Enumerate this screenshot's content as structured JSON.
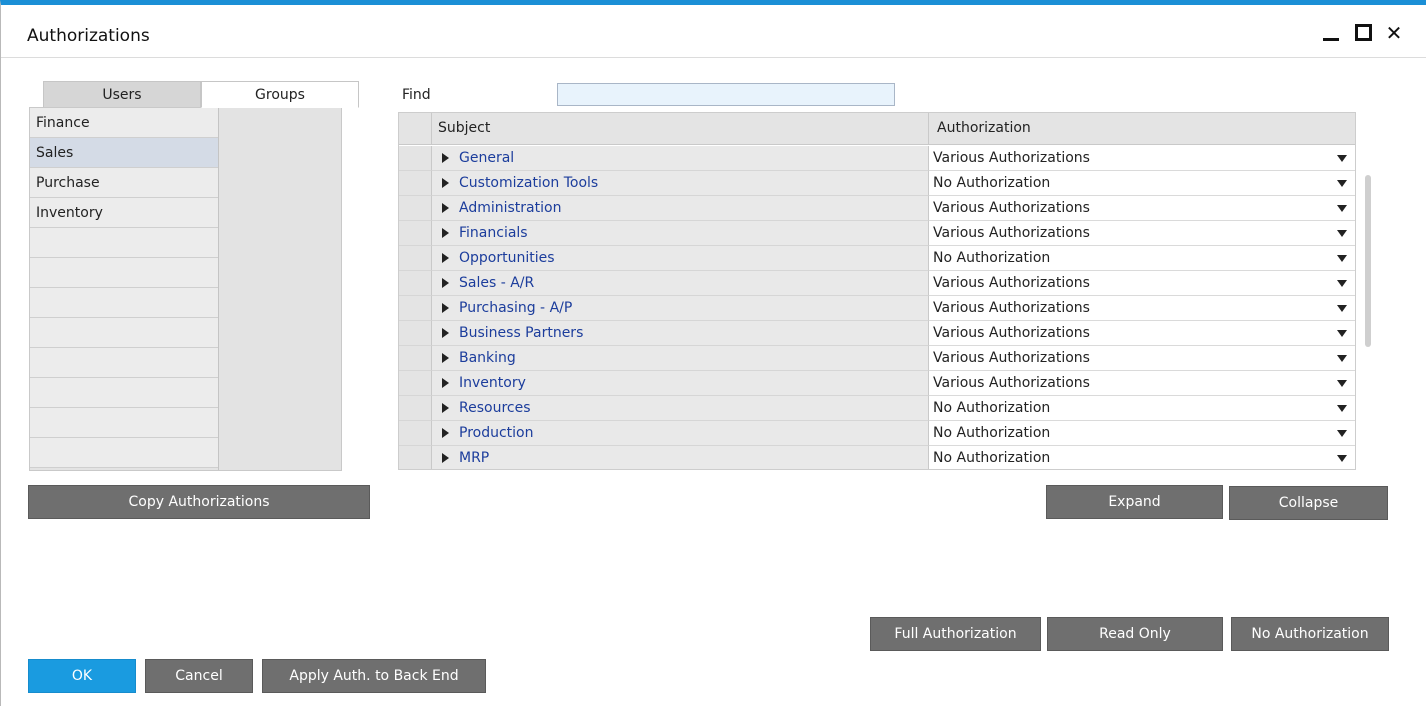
{
  "window": {
    "title": "Authorizations"
  },
  "tabs": [
    {
      "label": "Users"
    },
    {
      "label": "Groups"
    }
  ],
  "groups": [
    "Finance",
    "Sales",
    "Purchase",
    "Inventory"
  ],
  "selected_group": "Sales",
  "buttons": {
    "copy": "Copy Authorizations",
    "expand": "Expand",
    "collapse": "Collapse",
    "full": "Full Authorization",
    "read_only": "Read Only",
    "no_auth": "No Authorization",
    "ok": "OK",
    "cancel": "Cancel",
    "apply": "Apply Auth. to Back End"
  },
  "find": {
    "label": "Find",
    "value": ""
  },
  "grid": {
    "headers": {
      "subject": "Subject",
      "authorization": "Authorization"
    },
    "rows": [
      {
        "subject": "General",
        "authorization": "Various Authorizations"
      },
      {
        "subject": "Customization Tools",
        "authorization": "No Authorization"
      },
      {
        "subject": "Administration",
        "authorization": "Various Authorizations"
      },
      {
        "subject": "Financials",
        "authorization": "Various Authorizations"
      },
      {
        "subject": "Opportunities",
        "authorization": "No Authorization"
      },
      {
        "subject": "Sales - A/R",
        "authorization": "Various Authorizations"
      },
      {
        "subject": "Purchasing - A/P",
        "authorization": "Various Authorizations"
      },
      {
        "subject": "Business Partners",
        "authorization": "Various Authorizations"
      },
      {
        "subject": "Banking",
        "authorization": "Various Authorizations"
      },
      {
        "subject": "Inventory",
        "authorization": "Various Authorizations"
      },
      {
        "subject": "Resources",
        "authorization": "No Authorization"
      },
      {
        "subject": "Production",
        "authorization": "No Authorization"
      },
      {
        "subject": "MRP",
        "authorization": "No Authorization"
      }
    ]
  },
  "colors": {
    "accent": "#1b8fd6",
    "button": "#6f6f6f",
    "ok_button": "#1a9be0",
    "link_text": "#1c3d9c"
  }
}
